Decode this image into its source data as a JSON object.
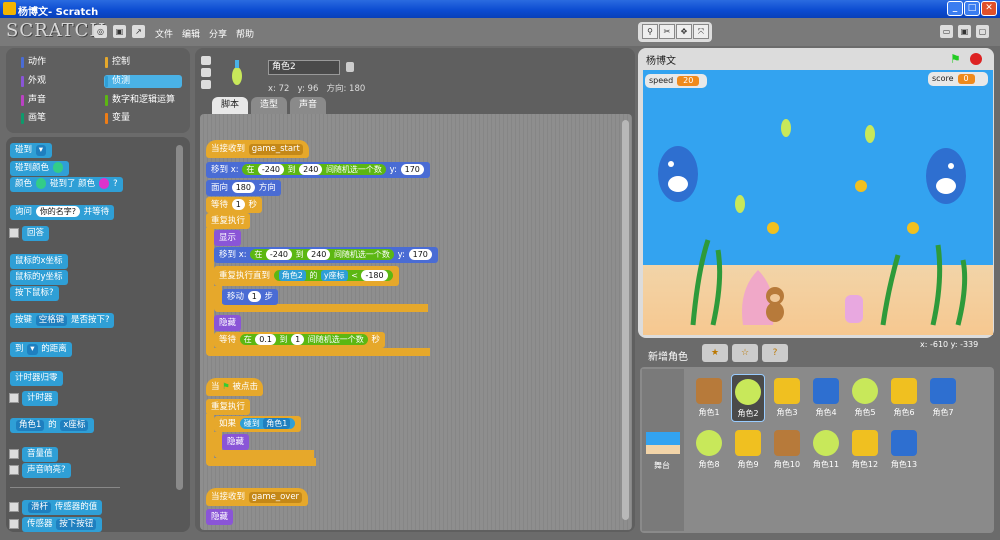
{
  "window": {
    "title": "杨博文- Scratch",
    "min": "_",
    "max": "□",
    "close": "✕"
  },
  "menu": {
    "logo": "SCRATCH",
    "items": [
      "文件",
      "编辑",
      "分享",
      "帮助"
    ]
  },
  "categories": [
    "动作",
    "控制",
    "外观",
    "侦测",
    "声音",
    "数字和逻辑运算",
    "画笔",
    "变量"
  ],
  "category_colors": [
    "#4a6cd4",
    "#e6a82b",
    "#8a55d7",
    "#2f9fd6",
    "#bb42c3",
    "#5cb712",
    "#0e9a6c",
    "#ee7d16"
  ],
  "palette": {
    "touching": "碰到",
    "touching_color": "碰到颜色",
    "color_touch_a": "颜色",
    "color_touch_b": "碰到了 颜色",
    "ask": "询问",
    "ask_value": "你的名字?",
    "ask_wait": "并等待",
    "answer": "回答",
    "mouse_x": "鼠标的x坐标",
    "mouse_y": "鼠标的y坐标",
    "mouse_down": "按下鼠标?",
    "key": "按键",
    "key_value": "空格键",
    "key_q": "是否按下?",
    "distance_a": "到",
    "distance_b": "的距离",
    "timer_reset": "计时器归零",
    "timer": "计时器",
    "of_a": "角色1",
    "of_b": "的",
    "of_c": "x座标",
    "loudness": "音量值",
    "loud": "声音响亮?",
    "slider": "滑杆",
    "sensor_value": "传感器的值",
    "sensor": "传感器",
    "sensor_b": "按下按钮"
  },
  "sprite_header": {
    "name": "角色2",
    "x_label": "x:",
    "x": "72",
    "y_label": "y:",
    "y": "96",
    "dir_label": "方向:",
    "dir": "180"
  },
  "tabs": [
    "脚本",
    "造型",
    "声音"
  ],
  "script1": {
    "hat": "当接收到",
    "hat_msg": "game_start",
    "goto": "移到 x:",
    "pick": "在",
    "r1a": "-240",
    "r1to": "到",
    "r1b": "240",
    "rand": "间随机选一个数",
    "y_lbl": "y:",
    "y_val": "170",
    "point": "面向",
    "point_val": "180",
    "direction": "方向",
    "wait": "等待",
    "wait_val": "1",
    "sec": "秒",
    "forever": "重复执行",
    "show": "显示",
    "repeat_until": "重复执行直到",
    "of_sprite": "角色2",
    "of_word": "的",
    "of_attr": "y座标",
    "lt": "<",
    "lt_val": "-180",
    "move": "移动",
    "move_val": "1",
    "steps": "步",
    "hide": "隐藏",
    "w2a": "0.1",
    "w2b": "1"
  },
  "script2": {
    "hat": "当",
    "hat_b": "被点击",
    "forever": "重复执行",
    "if": "如果",
    "touch": "碰到",
    "touch_val": "角色1",
    "hide": "隐藏"
  },
  "script3": {
    "hat": "当接收到",
    "hat_msg": "game_over",
    "hide": "隐藏"
  },
  "stage": {
    "title": "杨博文",
    "monitors": [
      {
        "name": "speed",
        "value": "20"
      },
      {
        "name": "score",
        "value": "0"
      }
    ],
    "coords": "x: -610  y: -339"
  },
  "sprites_panel": {
    "new_label": "新增角色",
    "stage_label": "舞台",
    "sprites": [
      "角色1",
      "角色2",
      "角色3",
      "角色4",
      "角色5",
      "角色6",
      "角色7",
      "角色8",
      "角色9",
      "角色10",
      "角色11",
      "角色12",
      "角色13"
    ]
  }
}
